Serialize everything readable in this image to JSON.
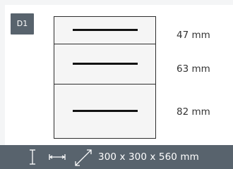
{
  "badge": {
    "label": "D1"
  },
  "drawers": [
    {
      "height_label": "47 mm"
    },
    {
      "height_label": "63 mm"
    },
    {
      "height_label": "82 mm"
    }
  ],
  "footer": {
    "icons": [
      "height-icon",
      "width-icon",
      "depth-icon"
    ],
    "dimensions": "300 x 300 x 560 mm"
  },
  "colors": {
    "badge_bg": "#58636d",
    "footer_bg": "#58636d",
    "drawer_fill": "#f5f5f5",
    "handle": "#121212"
  }
}
